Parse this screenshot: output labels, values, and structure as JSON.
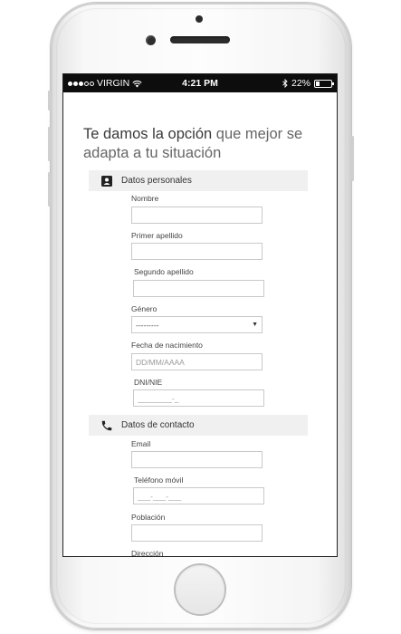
{
  "status_bar": {
    "carrier": "VIRGIN",
    "time": "4:21 PM",
    "battery": "22%",
    "battery_level": 0.22
  },
  "headline": {
    "part1": "Te damos la opción ",
    "part2": "que mejor se adapta a tu situación",
    "part1_color": "#3a3a3a",
    "part2_color": "#666666"
  },
  "sections": {
    "personal": {
      "title": "Datos personales",
      "icon": "id-card-icon",
      "fields": {
        "nombre": {
          "label": "Nombre",
          "value": "",
          "placeholder": ""
        },
        "primer_apellido": {
          "label": "Primer apellido",
          "value": "",
          "placeholder": ""
        },
        "segundo_apellido": {
          "label": "Segundo apellido",
          "value": "",
          "placeholder": ""
        },
        "genero": {
          "label": "Género",
          "selected": "---------"
        },
        "fecha_nacimiento": {
          "label": "Fecha de nacimiento",
          "value": "",
          "placeholder": "DD/MM/AAAA"
        },
        "dni": {
          "label": "DNI/NIE",
          "value": "",
          "placeholder": "________-_"
        }
      }
    },
    "contact": {
      "title": "Datos de contacto",
      "icon": "phone-icon",
      "fields": {
        "email": {
          "label": "Email",
          "value": "",
          "placeholder": ""
        },
        "telefono": {
          "label": "Teléfono móvil",
          "value": "",
          "placeholder": "___-___-___"
        },
        "poblacion": {
          "label": "Población",
          "value": "",
          "placeholder": ""
        },
        "direccion": {
          "label": "Dirección",
          "value": "",
          "placeholder": ""
        }
      }
    }
  }
}
